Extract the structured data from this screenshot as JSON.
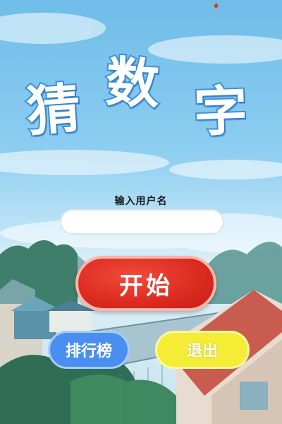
{
  "title": {
    "chars": [
      "猜",
      "数",
      "字"
    ]
  },
  "username": {
    "label": "输入用户名",
    "value": "",
    "placeholder": ""
  },
  "buttons": {
    "start": "开始",
    "leaderboard": "排行榜",
    "quit": "退出"
  },
  "colors": {
    "title_stroke": "#3f8fd8",
    "start": "#dc2a20",
    "leaderboard": "#4a8ff0",
    "quit": "#f4ec35"
  },
  "icons": [
    "red-kite"
  ]
}
